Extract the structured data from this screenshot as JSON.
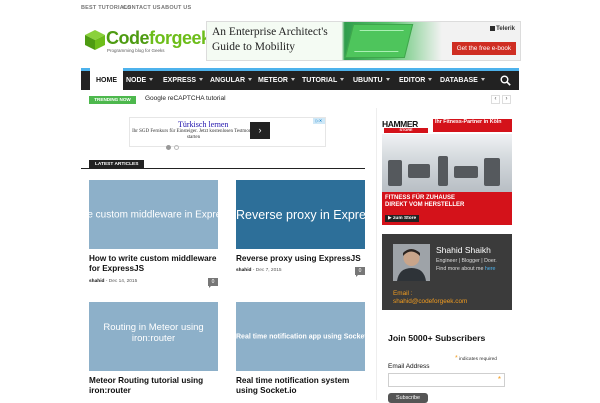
{
  "topbar": {
    "links": [
      "Best tutorials",
      "Contact us",
      "About us"
    ]
  },
  "logo": {
    "brand_part1": "Code",
    "brand_part2": "forgeek",
    "tagline": "Programming blog for Geeks"
  },
  "ad_banner": {
    "line1": "An Enterprise Architect's",
    "line2": "Guide to Mobility",
    "brand": "Telerik",
    "cta": "Get the free e-book"
  },
  "nav": {
    "items": [
      {
        "label": "Home",
        "has_caret": false
      },
      {
        "label": "Node",
        "has_caret": true
      },
      {
        "label": "Express",
        "has_caret": true
      },
      {
        "label": "Angular",
        "has_caret": true
      },
      {
        "label": "Meteor",
        "has_caret": true
      },
      {
        "label": "Tutorial",
        "has_caret": true
      },
      {
        "label": "Ubuntu",
        "has_caret": true
      },
      {
        "label": "Editor",
        "has_caret": true
      },
      {
        "label": "Database",
        "has_caret": true
      }
    ],
    "search_icon": "search-icon"
  },
  "trending": {
    "badge": "Trending Now",
    "text": "Google reCAPTCHA tutorial",
    "prev": "‹",
    "next": "›"
  },
  "small_ad": {
    "title": "Türkisch lernen",
    "desc": "Ihr SGD Fernkurs für Einsteiger. Jetzt kostenlosen Testmonat starten",
    "arrow": "›",
    "adchoice": "▷✕"
  },
  "latest": {
    "label": "Latest Articles",
    "cards": [
      {
        "img_caption": "rite custom middleware in Express",
        "img_color": "#8db0c9",
        "title": "How to write custom middleware for ExpressJS",
        "author": "shahid",
        "date": "Dec 14, 2015",
        "comments": "0"
      },
      {
        "img_caption": "Reverse proxy in ExpressJS",
        "img_color": "#2d6f99",
        "title": "Reverse proxy using ExpressJS",
        "author": "shahid",
        "date": "Dec 7, 2015",
        "comments": "0"
      },
      {
        "img_caption_line1": "Routing in Meteor using",
        "img_caption_line2": "iron:router",
        "img_color": "#8db0c9",
        "title": "Meteor Routing tutorial using iron:router"
      },
      {
        "img_caption": "Real time notification app using Socket.io",
        "img_color": "#8db0c9",
        "title": "Real time notification system using Socket.io"
      }
    ]
  },
  "hammer_ad": {
    "logo": "HAMMER",
    "logo_sub": "STORE",
    "headline": "Ihr Fitness-Partner in Köln",
    "line1": "FITNESS FÜR ZUHAUSE",
    "line2": "DIREKT VOM HERSTELLER",
    "button": "▶ zum Store"
  },
  "author": {
    "name": "Shahid Shaikh",
    "bio1": "Engineer | Blogger | Doer.",
    "bio2_prefix": "Find more about me ",
    "bio2_link": "here",
    "email_label": "Email :",
    "email": "shahid@codeforgeek.com"
  },
  "subscribe": {
    "title": "Join 5000+ Subscribers",
    "required_star": "*",
    "required_text": " indicates required",
    "email_label": "Email Address",
    "field_star": "*",
    "button": "Subscribe"
  },
  "colors": {
    "nav_bg": "#222222",
    "nav_accent": "#4db2ec",
    "trending": "#4db84d",
    "brand_green": "#4e9b12",
    "hammer_red": "#d4121a",
    "author_bg": "#3b3b3b",
    "email_orange": "#f29c1f"
  }
}
